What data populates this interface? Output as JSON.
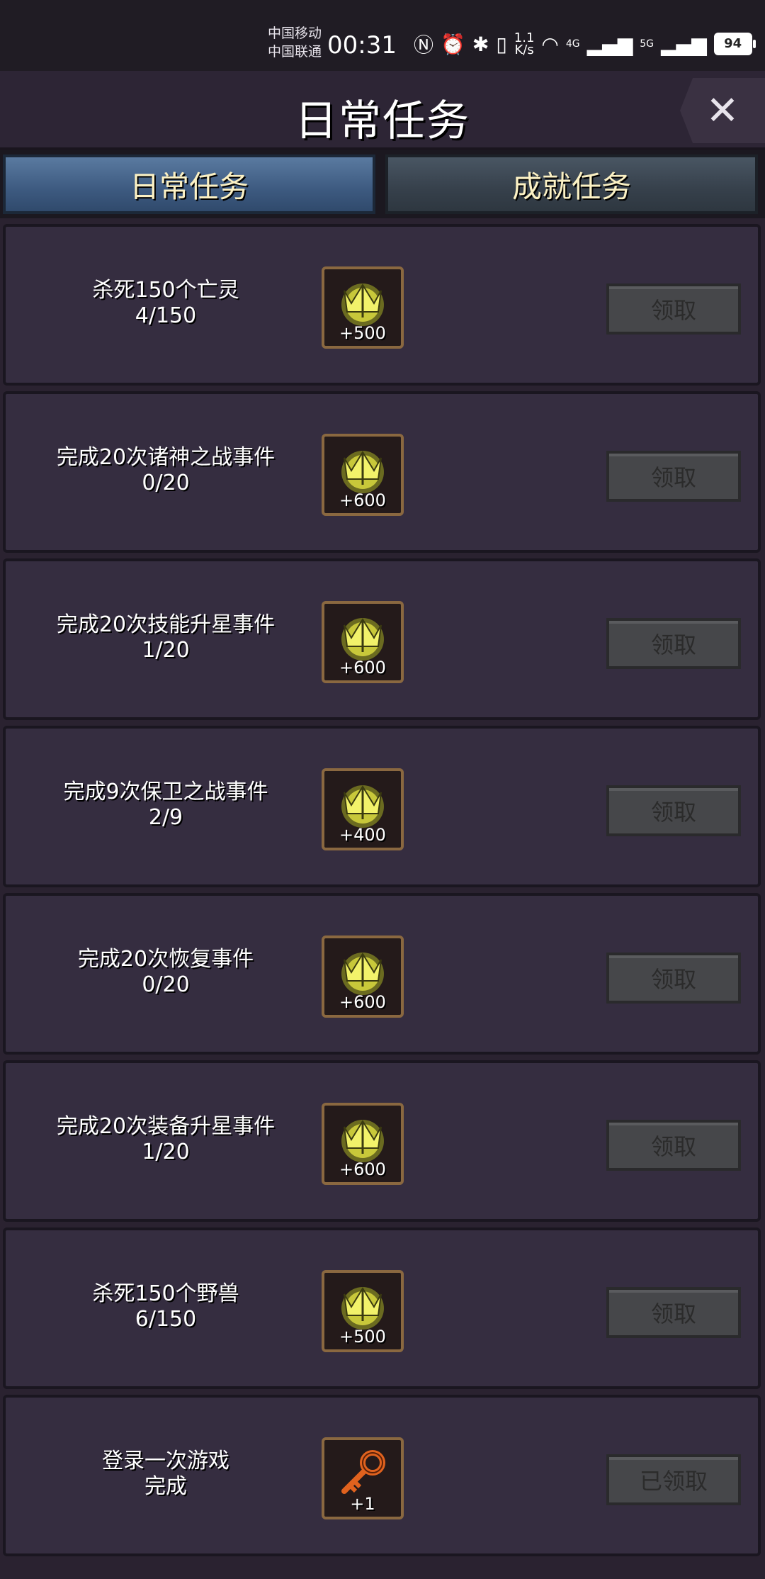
{
  "status_bar": {
    "carrier1": "中国移动",
    "carrier2": "中国联通",
    "time": "00:31",
    "net_speed_value": "1.1",
    "net_speed_unit": "K/s",
    "signal1_label": "4G",
    "signal2_label": "5G",
    "battery": "94"
  },
  "header": {
    "title": "日常任务",
    "close_label": "✕"
  },
  "tabs": [
    {
      "label": "日常任务",
      "active": true
    },
    {
      "label": "成就任务",
      "active": false
    }
  ],
  "tasks": [
    {
      "title": "杀死150个亡灵",
      "progress": "4/150",
      "reward": "+500",
      "reward_icon": "gold-trident-emblem-icon",
      "button": "领取"
    },
    {
      "title": "完成20次诸神之战事件",
      "progress": "0/20",
      "reward": "+600",
      "reward_icon": "gold-trident-emblem-icon",
      "button": "领取"
    },
    {
      "title": "完成20次技能升星事件",
      "progress": "1/20",
      "reward": "+600",
      "reward_icon": "gold-trident-emblem-icon",
      "button": "领取"
    },
    {
      "title": "完成9次保卫之战事件",
      "progress": "2/9",
      "reward": "+400",
      "reward_icon": "gold-trident-emblem-icon",
      "button": "领取"
    },
    {
      "title": "完成20次恢复事件",
      "progress": "0/20",
      "reward": "+600",
      "reward_icon": "gold-trident-emblem-icon",
      "button": "领取"
    },
    {
      "title": "完成20次装备升星事件",
      "progress": "1/20",
      "reward": "+600",
      "reward_icon": "gold-trident-emblem-icon",
      "button": "领取"
    },
    {
      "title": "杀死150个野兽",
      "progress": "6/150",
      "reward": "+500",
      "reward_icon": "gold-trident-emblem-icon",
      "button": "领取"
    },
    {
      "title": "登录一次游戏",
      "progress": "完成",
      "reward": "+1",
      "reward_icon": "orange-key-icon",
      "button": "已领取"
    }
  ]
}
